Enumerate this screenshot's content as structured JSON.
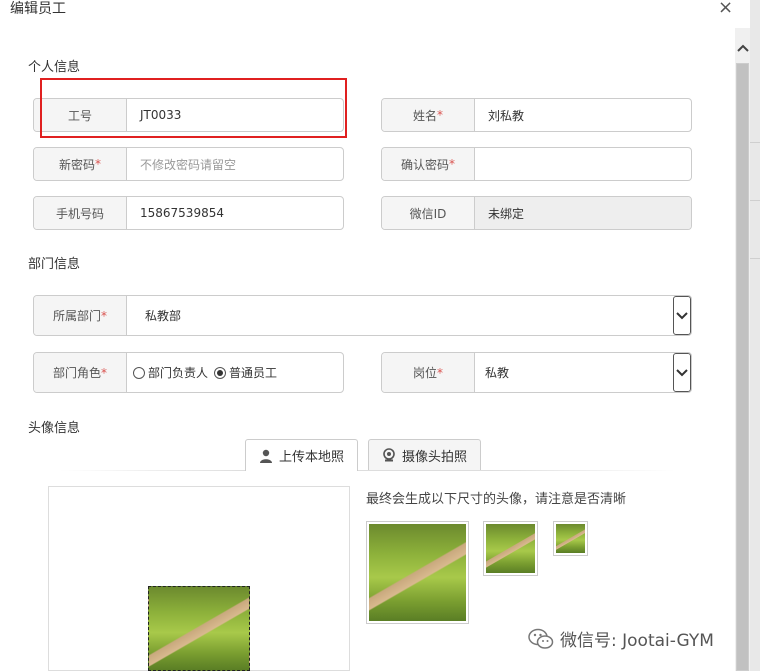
{
  "dialog": {
    "title": "编辑员工",
    "close": "×"
  },
  "sections": {
    "personal": "个人信息",
    "department": "部门信息",
    "avatar": "头像信息"
  },
  "fields": {
    "employee_no": {
      "label": "工号",
      "value": "JT0033"
    },
    "name": {
      "label": "姓名",
      "required": "*",
      "value": "刘私教"
    },
    "new_password": {
      "label": "新密码",
      "required": "*",
      "placeholder": "不修改密码请留空"
    },
    "confirm_password": {
      "label": "确认密码",
      "required": "*",
      "value": ""
    },
    "phone": {
      "label": "手机号码",
      "value": "15867539854"
    },
    "wechat": {
      "label": "微信ID",
      "value": "未绑定"
    },
    "department": {
      "label": "所属部门",
      "required": "*",
      "value": "私教部"
    },
    "role": {
      "label": "部门角色",
      "required": "*",
      "options": [
        "部门负责人",
        "普通员工"
      ],
      "selected": "普通员工"
    },
    "position": {
      "label": "岗位",
      "required": "*",
      "value": "私教"
    }
  },
  "tabs": {
    "upload": "上传本地照",
    "camera": "摄像头拍照"
  },
  "preview": {
    "note": "最终会生成以下尺寸的头像，请注意是否清晰"
  },
  "watermark": {
    "text": "微信号: Jootai-GYM"
  },
  "icons": {
    "close": "close-icon",
    "scroll_up": "chevron-up-icon",
    "select_arrow": "chevron-down-icon",
    "user": "user-icon",
    "webcam": "webcam-icon",
    "wechat": "wechat-icon"
  },
  "colors": {
    "required": "#d9534f",
    "highlight": "#e02020"
  }
}
